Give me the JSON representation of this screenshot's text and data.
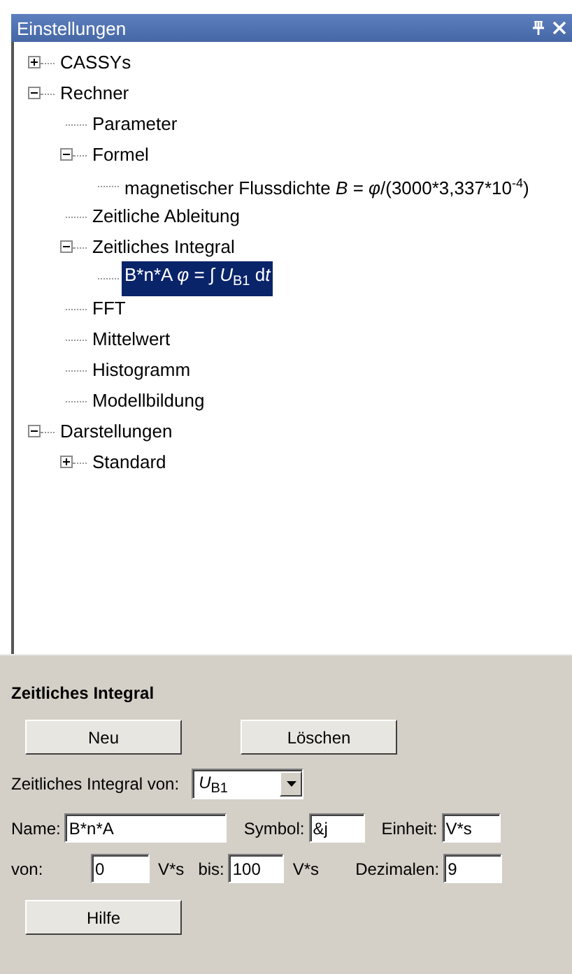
{
  "window": {
    "title": "Einstellungen"
  },
  "tree": [
    {
      "label": "CASSYs",
      "expanded": false,
      "selected": false
    },
    {
      "label": "Rechner",
      "expanded": true,
      "selected": false,
      "children": [
        {
          "label": "Parameter",
          "selected": false
        },
        {
          "label": "Formel",
          "expanded": true,
          "selected": false,
          "children": [
            {
              "label": "magnetischer Flussdichte",
              "selected": false,
              "formula": [
                {
                  "text": "B",
                  "kind": "symbol"
                },
                {
                  "text": " = ",
                  "kind": "text"
                },
                {
                  "text": "φ",
                  "kind": "symbol"
                },
                {
                  "text": "/(3000*3,337*10",
                  "kind": "text"
                },
                {
                  "text": "-4",
                  "kind": "exponent"
                },
                {
                  "text": ")",
                  "kind": "text"
                }
              ]
            }
          ]
        },
        {
          "label": "Zeitliche Ableitung",
          "selected": false
        },
        {
          "label": "Zeitliches Integral",
          "expanded": true,
          "selected": false,
          "children": [
            {
              "label": "B*n*A",
              "selected": true,
              "formula": [
                {
                  "text": "φ",
                  "kind": "symbol"
                },
                {
                  "text": " = ∫ ",
                  "kind": "text"
                },
                {
                  "text": "U",
                  "kind": "symbol"
                },
                {
                  "text": "B1",
                  "kind": "index"
                },
                {
                  "text": " d",
                  "kind": "text"
                },
                {
                  "text": "t",
                  "kind": "symbol"
                }
              ]
            }
          ]
        },
        {
          "label": "FFT",
          "selected": false
        },
        {
          "label": "Mittelwert",
          "selected": false
        },
        {
          "label": "Histogramm",
          "selected": false
        },
        {
          "label": "Modellbildung",
          "selected": false
        }
      ]
    },
    {
      "label": "Darstellungen",
      "expanded": true,
      "selected": false,
      "children": [
        {
          "label": "Standard",
          "expanded": false,
          "selected": false
        }
      ]
    }
  ],
  "panel": {
    "title": "Zeitliches Integral",
    "buttons": [
      "Neu",
      "Löschen"
    ],
    "source": {
      "label": "Zeitliches Integral von:",
      "value": [
        {
          "text": "U",
          "kind": "symbol"
        },
        {
          "text": "B1",
          "kind": "index"
        }
      ]
    },
    "name": {
      "label": "Name:",
      "value": "B*n*A"
    },
    "symbol": {
      "label": "Symbol:",
      "value": "&j"
    },
    "unit": {
      "label": "Einheit:",
      "value": "V*s"
    },
    "from": {
      "label": "von:",
      "value": "0",
      "unit": "V*s"
    },
    "to": {
      "label": "bis:",
      "value": "100",
      "unit": "V*s"
    },
    "decimals": {
      "label": "Dezimalen:",
      "value": "9"
    },
    "help_button": "Hilfe"
  }
}
